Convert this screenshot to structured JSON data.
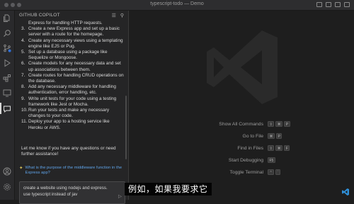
{
  "window": {
    "title": "typescript-todo — Demo"
  },
  "activity_bar": {
    "icons": [
      "files-icon",
      "search-icon",
      "source-control-icon",
      "run-debug-icon",
      "extensions-icon",
      "remote-explorer-icon",
      "chat-icon",
      "account-icon",
      "settings-gear-icon"
    ]
  },
  "sidebar": {
    "header": "GITHUB COPILOT",
    "list_items": [
      {
        "num": "",
        "text": "Express for handling HTTP requests."
      },
      {
        "num": "3.",
        "text": "Create a new Express app and set up a basic server with a route for the homepage."
      },
      {
        "num": "4.",
        "text": "Create any necessary views using a templating engine like EJS or Pug."
      },
      {
        "num": "5.",
        "text": "Set up a database using a package like Sequelize or Mongoose."
      },
      {
        "num": "6.",
        "text": "Create models for any necessary data and set up associations between them."
      },
      {
        "num": "7.",
        "text": "Create routes for handling CRUD operations on the database."
      },
      {
        "num": "8.",
        "text": "Add any necessary middleware for handling authentication, error handling, etc."
      },
      {
        "num": "9.",
        "text": "Write unit tests for your code using a testing framework like Jest or Mocha."
      },
      {
        "num": "10.",
        "text": "Run your tests and make any necessary changes to your code."
      },
      {
        "num": "11.",
        "text": "Deploy your app to a hosting service like Heroku or AWS."
      }
    ],
    "closing": "Let me know if you have any questions or need further assistance!",
    "suggestion": "What is the purpose of the middleware function in the Express app?",
    "input_value": "create a website using nodejs and express. use typescript instead of jav"
  },
  "editor": {
    "shortcuts": [
      {
        "label": "Show All Commands",
        "keys": [
          "⇧",
          "⌘",
          "P"
        ]
      },
      {
        "label": "Go to File",
        "keys": [
          "⌘",
          "P"
        ]
      },
      {
        "label": "Find in Files",
        "keys": [
          "⇧",
          "⌘",
          "F"
        ]
      },
      {
        "label": "Start Debugging",
        "keys": [
          "F5"
        ]
      },
      {
        "label": "Toggle Terminal",
        "keys": [
          "⌃",
          "`"
        ]
      }
    ]
  },
  "subtitle": "例如，如果我要求它",
  "colors": {
    "accent_blue": "#5fa3e8",
    "bg": "#1e1e1e",
    "sidebar": "#252526"
  }
}
